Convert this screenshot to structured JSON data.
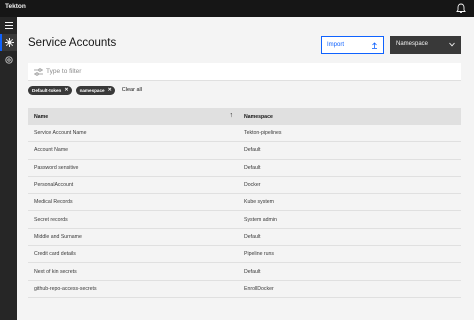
{
  "header": {
    "app_name": "Tekton"
  },
  "page": {
    "title": "Service Accounts"
  },
  "toolbar": {
    "import_label": "Import",
    "namespace_label": "Namespace"
  },
  "filter": {
    "placeholder": "Type to filter"
  },
  "tags": [
    {
      "label": "Default-token"
    },
    {
      "label": "namespace"
    }
  ],
  "clear_all": "Clear all",
  "table": {
    "headers": {
      "name": "Name",
      "namespace": "Namespace"
    },
    "rows": [
      {
        "name": "Service Account Name",
        "namespace": "Tekton-pipelines"
      },
      {
        "name": "Account Name",
        "namespace": "Default"
      },
      {
        "name": "Password sensitive",
        "namespace": "Default"
      },
      {
        "name": "PersonalAccount",
        "namespace": "Docker"
      },
      {
        "name": "Medical Records",
        "namespace": "Kube system"
      },
      {
        "name": "Secret records",
        "namespace": "System admin"
      },
      {
        "name": "Middle and Surname",
        "namespace": "Default"
      },
      {
        "name": "Credit card details",
        "namespace": "Pipeline runs"
      },
      {
        "name": "Next of kin secrets",
        "namespace": "Default"
      },
      {
        "name": "github-repo-access-secrets",
        "namespace": "EnrollDocker"
      }
    ]
  },
  "colors": {
    "accent": "#0f62fe",
    "header_bg": "#161616",
    "sidenav_bg": "#262626",
    "page_bg": "#f4f4f4"
  },
  "icons": {
    "menu": "menu-icon",
    "pipeline": "pipeline-icon",
    "settings": "settings-icon",
    "bell": "notification-icon",
    "filter": "filter-icon",
    "upload": "upload-icon",
    "sort": "sort-arrow-icon"
  }
}
